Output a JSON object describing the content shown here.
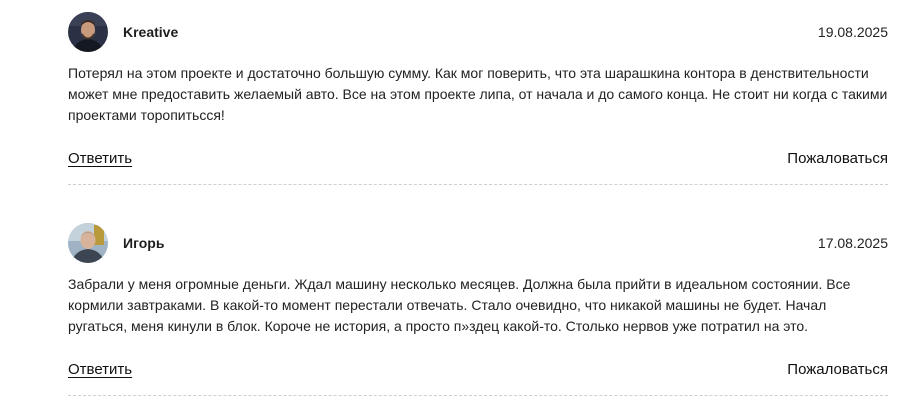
{
  "comments": [
    {
      "author": "Kreative",
      "date": "19.08.2025",
      "text": "Потерял на этом проекте и достаточно большую сумму. Как мог поверить, что эта шарашкина контора в денствительности может мне предоставить желаемый авто. Все на этом проекте липа, от начала и до самого конца. Не стоит ни когда с такими проектами торопитьсся!",
      "reply_label": "Ответить",
      "report_label": "Пожаловаться"
    },
    {
      "author": "Игорь",
      "date": "17.08.2025",
      "text": "Забрали у меня огромные деньги. Ждал машину несколько месяцев. Должна была прийти в идеальном состоянии. Все кормили завтраками. В какой-то момент перестали отвечать. Стало очевидно, что никакой машины не будет. Начал ругаться, меня кинули в блок. Короче не история, а просто п»здец какой-то. Столько нервов уже потратил на это.",
      "reply_label": "Ответить",
      "report_label": "Пожаловаться"
    }
  ]
}
